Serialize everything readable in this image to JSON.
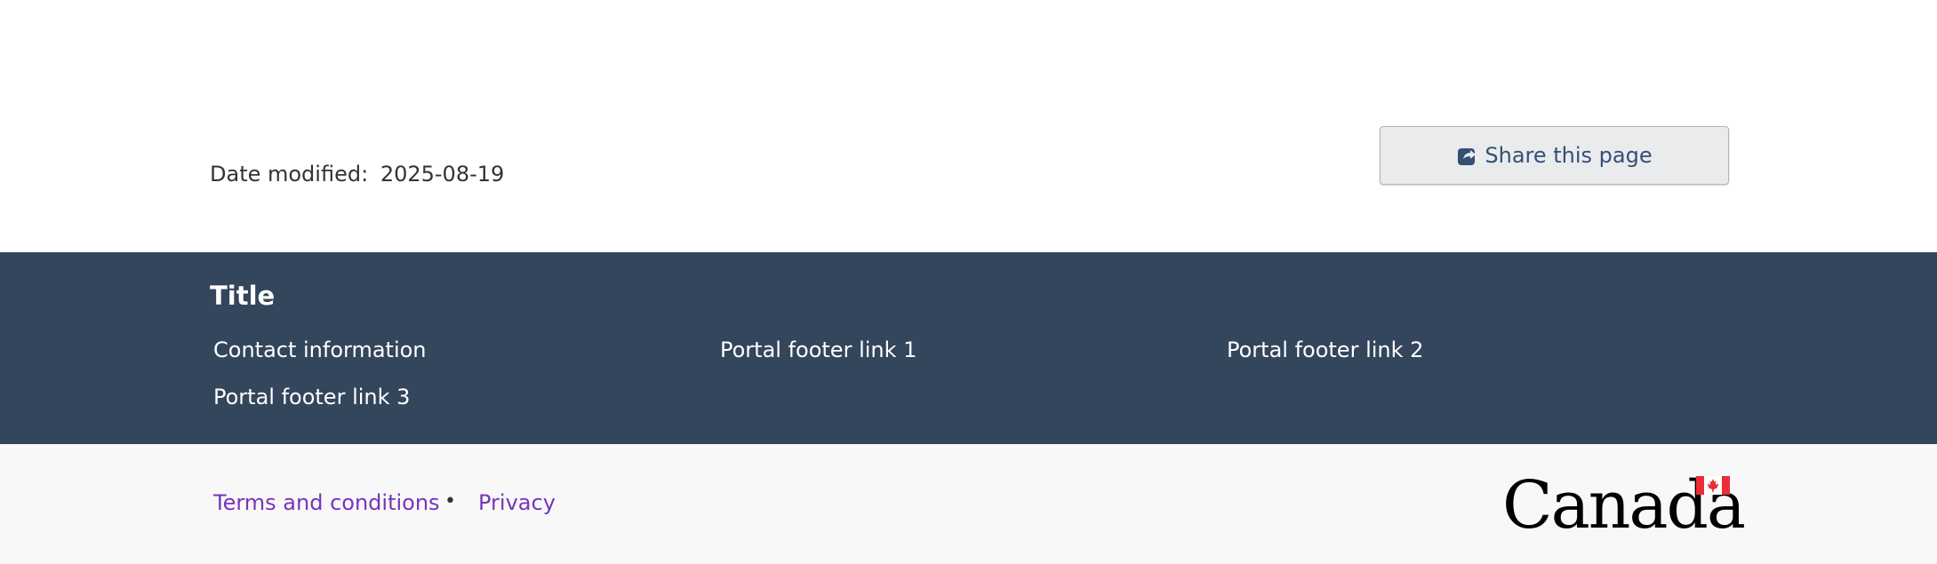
{
  "page": {
    "date_modified_label": "Date modified:",
    "date_modified_value": "2025-08-19",
    "share_button_label": "Share this page",
    "share_icon": "share-square-icon"
  },
  "footer": {
    "title": "Title",
    "links": [
      "Contact information",
      "Portal footer link 1",
      "Portal footer link 2",
      "Portal footer link 3"
    ],
    "background_color": "#33465c"
  },
  "sub_footer": {
    "links": [
      "Terms and conditions",
      "Privacy"
    ],
    "separator": "•",
    "link_color": "#7834bc",
    "wordmark_text": "Canada",
    "wordmark_icon": "canada-flag-icon"
  }
}
